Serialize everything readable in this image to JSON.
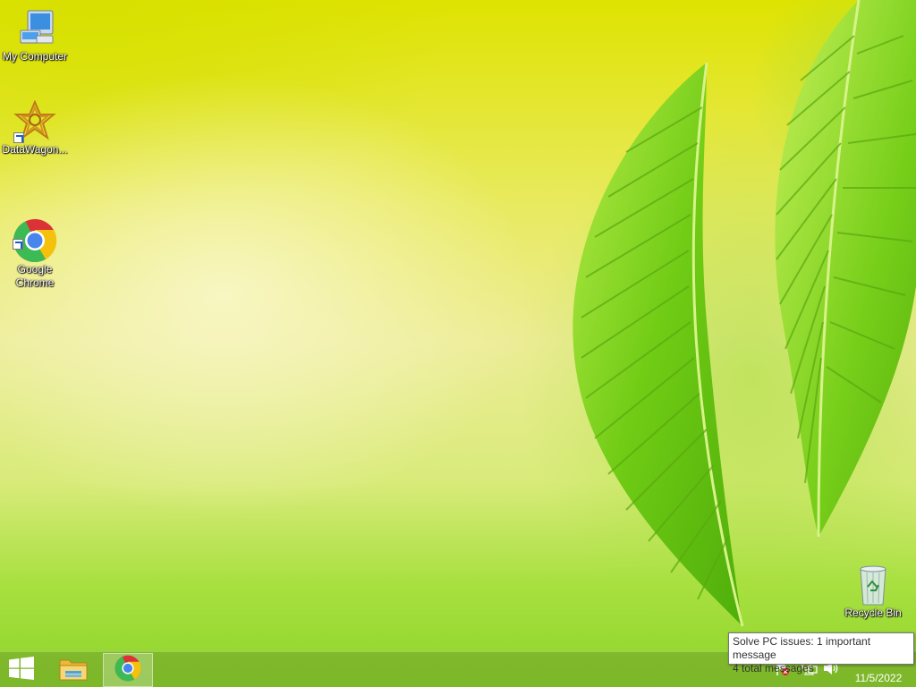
{
  "desktop": {
    "icons": [
      {
        "label": "My Computer"
      },
      {
        "label": "DataWagon..."
      },
      {
        "label": "Google\nChrome"
      },
      {
        "label": "Recycle Bin"
      }
    ]
  },
  "taskbar": {
    "start_icon": "windows-logo-icon",
    "pinned": [
      {
        "name": "File Explorer",
        "icon": "file-explorer-icon"
      },
      {
        "name": "Google Chrome",
        "icon": "chrome-icon",
        "active": true
      }
    ]
  },
  "tray": {
    "action_center_icon": "action-center-flag-icon",
    "network_icon": "network-icon",
    "volume_icon": "volume-icon",
    "clock": {
      "date": "11/5/2022"
    }
  },
  "tooltip": {
    "line1": "Solve PC issues: 1 important message",
    "line2": "4 total messages"
  },
  "colors": {
    "wallpaper_top": "#dfe300",
    "wallpaper_bottom": "#8ed42a",
    "leaf": "#7fd21a"
  }
}
